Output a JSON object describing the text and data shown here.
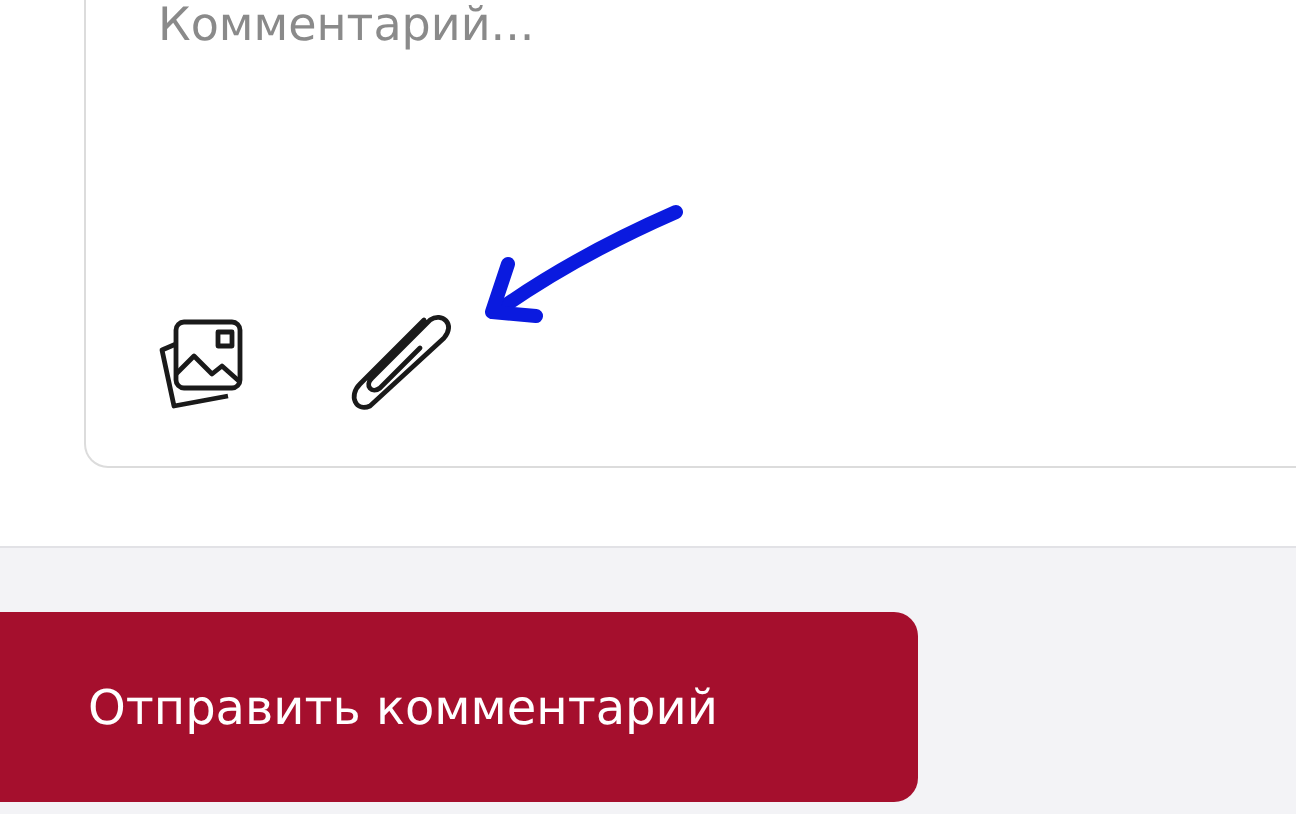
{
  "comment": {
    "placeholder": "Комментарий..."
  },
  "attachments": [
    {
      "kind": "images"
    },
    {
      "kind": "clip"
    }
  ],
  "annotation": {
    "kind": "arrow"
  },
  "submit": {
    "label": "Отправить комментарий"
  }
}
